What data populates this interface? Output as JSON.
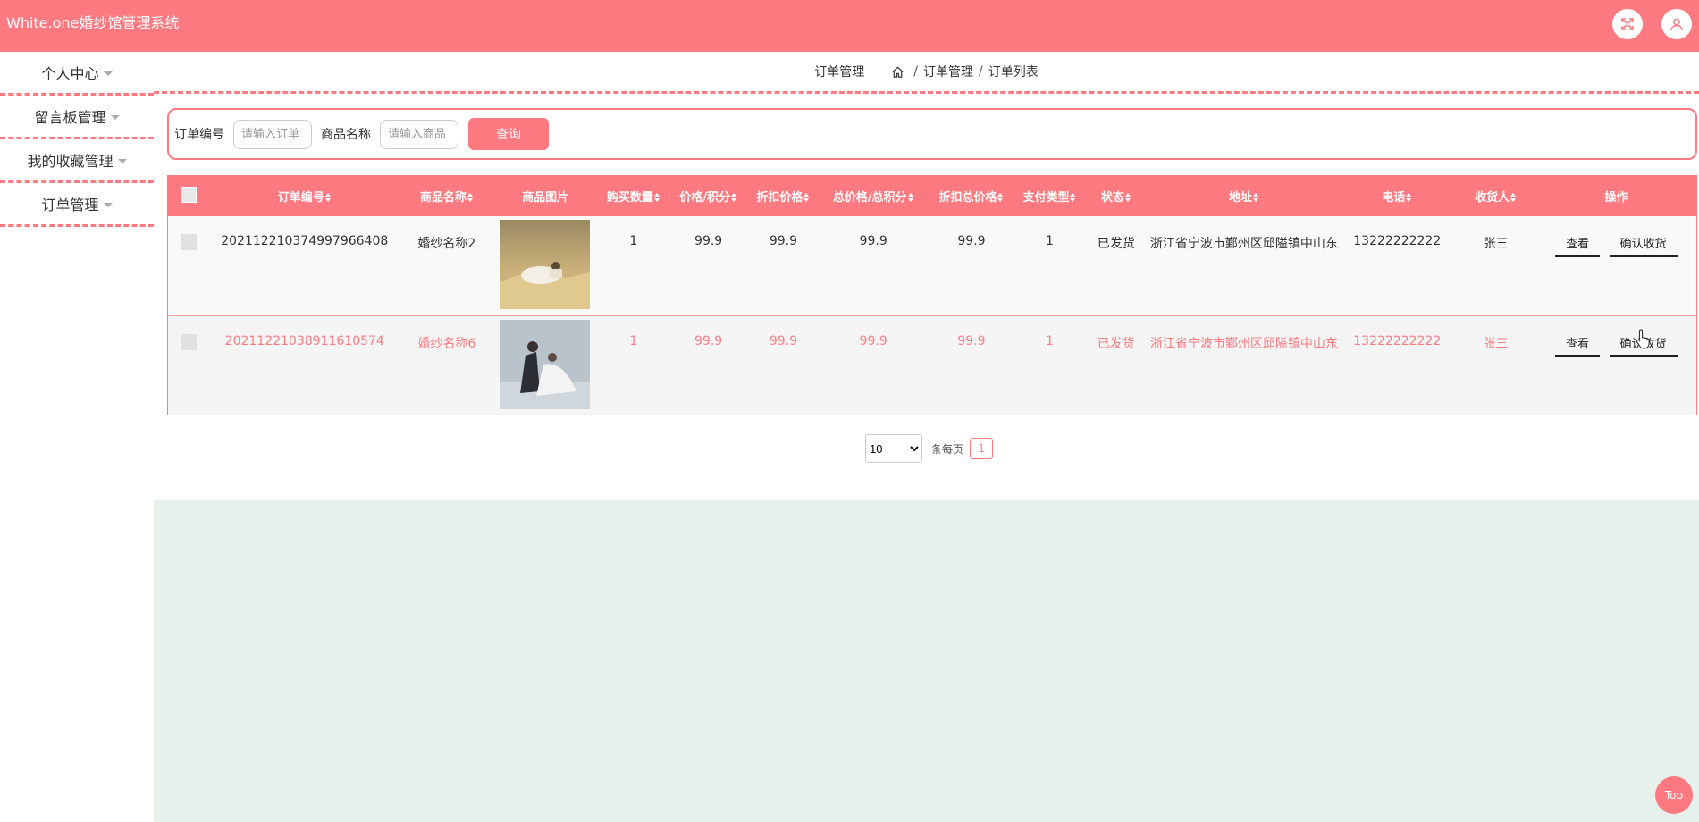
{
  "app": {
    "title": "White.one婚纱馆管理系统"
  },
  "header": {
    "fullscreen_icon": "fullscreen-icon",
    "user_icon": "user-icon"
  },
  "sidebar": {
    "items": [
      {
        "label": "个人中心"
      },
      {
        "label": "留言板管理"
      },
      {
        "label": "我的收藏管理"
      },
      {
        "label": "订单管理"
      }
    ]
  },
  "breadcrumb": {
    "section": "订单管理",
    "path": [
      "订单管理",
      "订单列表"
    ],
    "separator": "/"
  },
  "search": {
    "order_label": "订单编号",
    "order_placeholder": "请输入订单",
    "product_label": "商品名称",
    "product_placeholder": "请输入商品",
    "query_button": "查询"
  },
  "table": {
    "columns": [
      "订单编号",
      "商品名称",
      "商品图片",
      "购买数量",
      "价格/积分",
      "折扣价格",
      "总价格/总积分",
      "折扣总价格",
      "支付类型",
      "状态",
      "地址",
      "电话",
      "收货人",
      "操作"
    ],
    "rows": [
      {
        "order_no": "20211221037499796640​8",
        "product": "婚纱名称2",
        "qty": "1",
        "price": "99.9",
        "discount_price": "99.9",
        "total": "99.9",
        "discount_total": "99.9",
        "pay_type": "1",
        "status": "已发货",
        "address": "浙江省宁波市鄞州区邱隘镇中山东路",
        "phone": "13222222222",
        "receiver": "张三",
        "actions": [
          "查看",
          "确认收货"
        ]
      },
      {
        "order_no": "20211221038911610574",
        "product": "婚纱名称6",
        "qty": "1",
        "price": "99.9",
        "discount_price": "99.9",
        "total": "99.9",
        "discount_total": "99.9",
        "pay_type": "1",
        "status": "已发货",
        "address": "浙江省宁波市鄞州区邱隘镇中山东路",
        "phone": "13222222222",
        "receiver": "张三",
        "actions": [
          "查看",
          "确认收货"
        ]
      }
    ]
  },
  "pagination": {
    "page_size": "10",
    "per_page_label": "条每页",
    "current_page": "1"
  },
  "back_to_top": "Top",
  "colors": {
    "accent": "#ff7a80",
    "footer_bg": "#e7f1ec"
  }
}
